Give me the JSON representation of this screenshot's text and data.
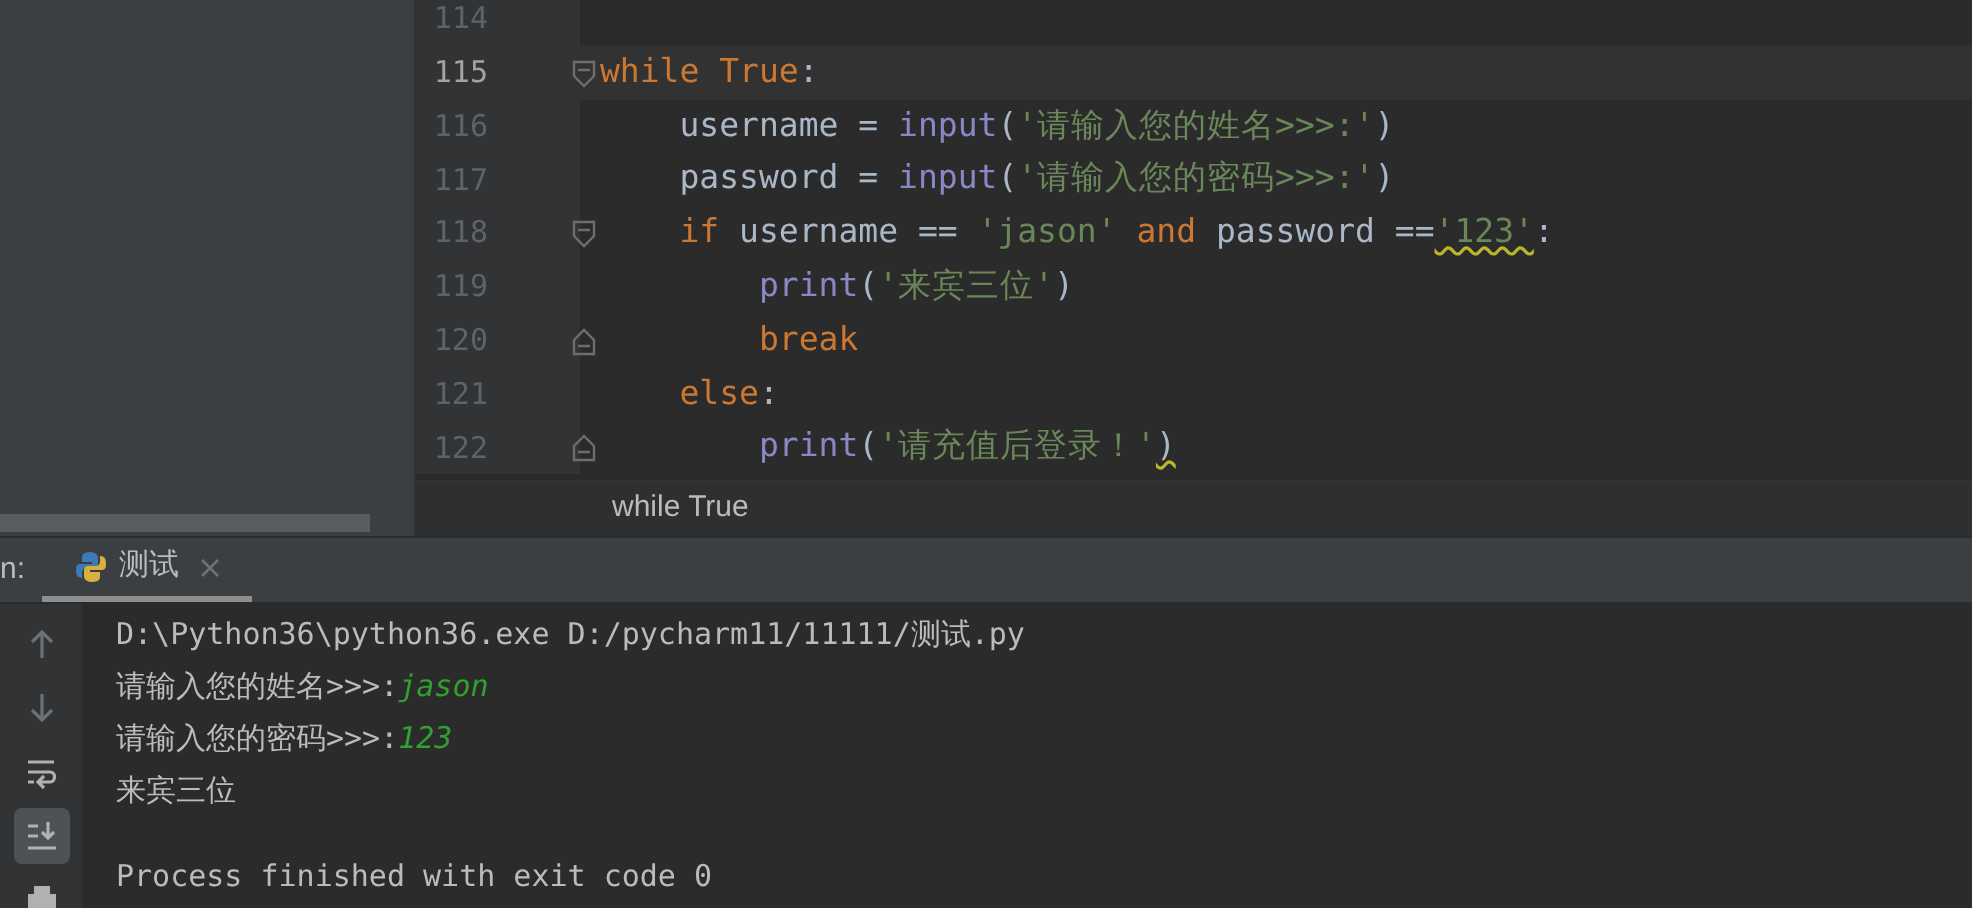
{
  "editor": {
    "lines": [
      {
        "number": "114",
        "current": false
      },
      {
        "number": "115",
        "current": true,
        "fold_open": true,
        "tokens": [
          {
            "text": "while",
            "kind": "keyword"
          },
          {
            "text": " True",
            "kind": "keyword"
          },
          {
            "text": ":",
            "kind": "plain"
          }
        ]
      },
      {
        "number": "116",
        "current": false,
        "tokens": [
          {
            "text": "    username = ",
            "kind": "plain"
          },
          {
            "text": "input",
            "kind": "builtin"
          },
          {
            "text": "(",
            "kind": "plain"
          },
          {
            "text": "'请输入您的姓名>>>:'",
            "kind": "string"
          },
          {
            "text": ")",
            "kind": "plain"
          }
        ]
      },
      {
        "number": "117",
        "current": false,
        "tokens": [
          {
            "text": "    password = ",
            "kind": "plain"
          },
          {
            "text": "input",
            "kind": "builtin"
          },
          {
            "text": "(",
            "kind": "plain"
          },
          {
            "text": "'请输入您的密码>>>:'",
            "kind": "string"
          },
          {
            "text": ")",
            "kind": "plain"
          }
        ]
      },
      {
        "number": "118",
        "current": false,
        "fold_open": true,
        "tokens": [
          {
            "text": "    if",
            "kind": "keyword"
          },
          {
            "text": " username == ",
            "kind": "plain"
          },
          {
            "text": "'jason'",
            "kind": "string"
          },
          {
            "text": " and",
            "kind": "keyword"
          },
          {
            "text": " password ==",
            "kind": "plain"
          },
          {
            "text": "'123'",
            "kind": "string",
            "warning": true
          },
          {
            "text": ":",
            "kind": "plain"
          }
        ]
      },
      {
        "number": "119",
        "current": false,
        "tokens": [
          {
            "text": "        print",
            "kind": "builtin"
          },
          {
            "text": "(",
            "kind": "plain"
          },
          {
            "text": "'来宾三位'",
            "kind": "string"
          },
          {
            "text": ")",
            "kind": "plain"
          }
        ]
      },
      {
        "number": "120",
        "current": false,
        "fold_close": true,
        "tokens": [
          {
            "text": "        break",
            "kind": "keyword"
          }
        ]
      },
      {
        "number": "121",
        "current": false,
        "tokens": [
          {
            "text": "    else",
            "kind": "keyword"
          },
          {
            "text": ":",
            "kind": "plain"
          }
        ]
      },
      {
        "number": "122",
        "current": false,
        "fold_close": true,
        "tokens": [
          {
            "text": "        print",
            "kind": "builtin"
          },
          {
            "text": "(",
            "kind": "plain"
          },
          {
            "text": "'请充值后登录！'",
            "kind": "string"
          },
          {
            "text": ")",
            "kind": "plain",
            "warning": true
          }
        ]
      }
    ]
  },
  "breadcrumb": "while True",
  "run_panel": {
    "label": "n:",
    "tabs": [
      {
        "label": "测试",
        "selected": true
      }
    ],
    "toolbar": [
      {
        "kind": "up",
        "selected": false
      },
      {
        "kind": "down",
        "selected": false
      },
      {
        "kind": "wrap",
        "selected": false
      },
      {
        "kind": "scroll-end",
        "selected": true
      },
      {
        "kind": "print",
        "selected": false
      }
    ]
  },
  "console": [
    {
      "segments": [
        {
          "text": "D:\\Python36\\python36.exe D:/pycharm11/11111/测试.py",
          "kind": "output"
        }
      ]
    },
    {
      "segments": [
        {
          "text": "请输入您的姓名>>>:",
          "kind": "output"
        },
        {
          "text": "jason",
          "kind": "input"
        }
      ]
    },
    {
      "segments": [
        {
          "text": "请输入您的密码>>>:",
          "kind": "output"
        },
        {
          "text": "123",
          "kind": "input"
        }
      ]
    },
    {
      "segments": [
        {
          "text": "来宾三位",
          "kind": "output"
        }
      ]
    },
    {
      "blank_line_before": true,
      "segments": [
        {
          "text": "Process finished with exit code 0",
          "kind": "output"
        }
      ]
    }
  ]
}
